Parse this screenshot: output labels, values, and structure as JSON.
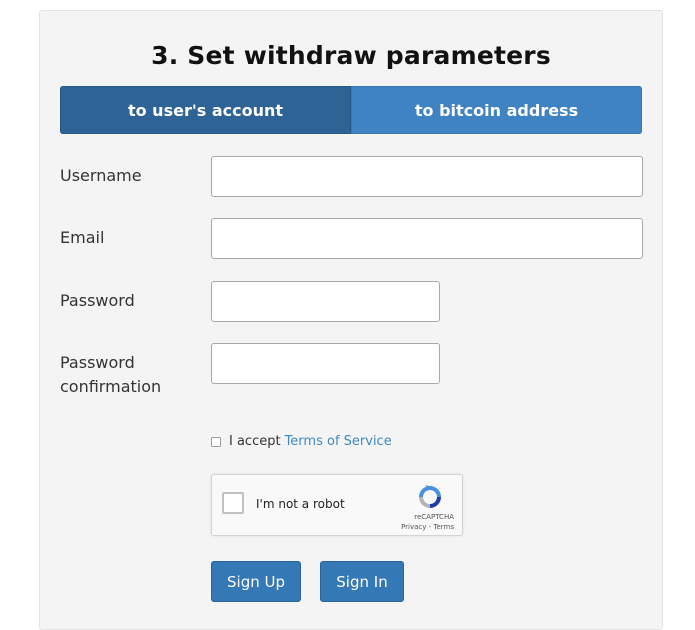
{
  "header": {
    "title": "3. Set withdraw parameters"
  },
  "tabs": [
    {
      "label": "to user's account",
      "active": true
    },
    {
      "label": "to bitcoin address",
      "active": false
    }
  ],
  "form": {
    "username_label": "Username",
    "email_label": "Email",
    "password_label": "Password",
    "password_confirmation_label_line1": "Password",
    "password_confirmation_label_line2": "confirmation",
    "username_value": "",
    "email_value": "",
    "password_value": "",
    "password_confirmation_value": ""
  },
  "terms": {
    "prefix": "I accept",
    "link_text": "Terms of Service",
    "checked": false
  },
  "recaptcha": {
    "label": "I'm not a robot",
    "brand": "reCAPTCHA",
    "links": "Privacy - Terms",
    "icon": "recaptcha-logo-icon"
  },
  "buttons": {
    "sign_up": "Sign Up",
    "sign_in": "Sign In"
  },
  "colors": {
    "tab_active": "#2e6395",
    "tab_inactive": "#3f83c2",
    "button": "#3478b5",
    "link": "#3d8ac3",
    "panel_bg": "#f4f4f4"
  }
}
